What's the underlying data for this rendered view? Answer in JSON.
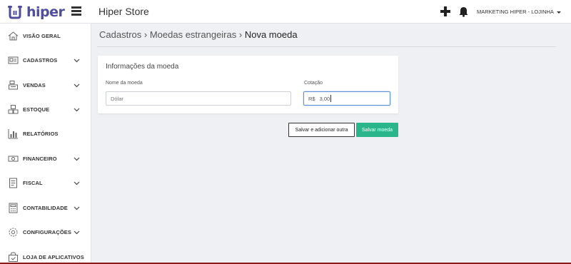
{
  "header": {
    "logo_text": "hiper",
    "store_name": "Hiper Store",
    "user_menu_label": "MARKETING HIPER - LOJINHA",
    "icons": {
      "menu": "hamburger-icon",
      "add": "plus-icon",
      "notifications": "bell-icon"
    }
  },
  "sidebar": {
    "items": [
      {
        "label": "VISÃO GERAL",
        "icon": "home-icon",
        "expandable": false
      },
      {
        "label": "CADASTROS",
        "icon": "id-card-icon",
        "expandable": true
      },
      {
        "label": "VENDAS",
        "icon": "cash-register-icon",
        "expandable": true
      },
      {
        "label": "ESTOQUE",
        "icon": "boxes-icon",
        "expandable": true
      },
      {
        "label": "RELATÓRIOS",
        "icon": "bar-chart-icon",
        "expandable": false
      },
      {
        "label": "FINANCEIRO",
        "icon": "banknote-icon",
        "expandable": true
      },
      {
        "label": "FISCAL",
        "icon": "document-icon",
        "expandable": true
      },
      {
        "label": "CONTABILIDADE",
        "icon": "calculator-icon",
        "expandable": true
      },
      {
        "label": "CONFIGURAÇÕES",
        "icon": "gear-icon",
        "expandable": true
      },
      {
        "label": "LOJA DE APLICATIVOS",
        "icon": "store-bag-icon",
        "expandable": false
      }
    ]
  },
  "breadcrumb": {
    "items": [
      "Cadastros",
      "Moedas estrangeiras"
    ],
    "separator": "›",
    "current": "Nova moeda"
  },
  "form": {
    "title": "Informações da moeda",
    "name_label": "Nome da moeda",
    "name_placeholder": "Dólar",
    "name_value": "",
    "rate_label": "Cotação",
    "rate_prefix": "R$",
    "rate_value": "3,00"
  },
  "actions": {
    "save_and_add_label": "Salvar e adicionar outra",
    "save_label": "Salvar moeda"
  },
  "colors": {
    "brand": "#4f4e9c",
    "primary_button": "#2bb58a",
    "focus_border": "#5b8fd6",
    "page_background": "#eff0f4"
  }
}
